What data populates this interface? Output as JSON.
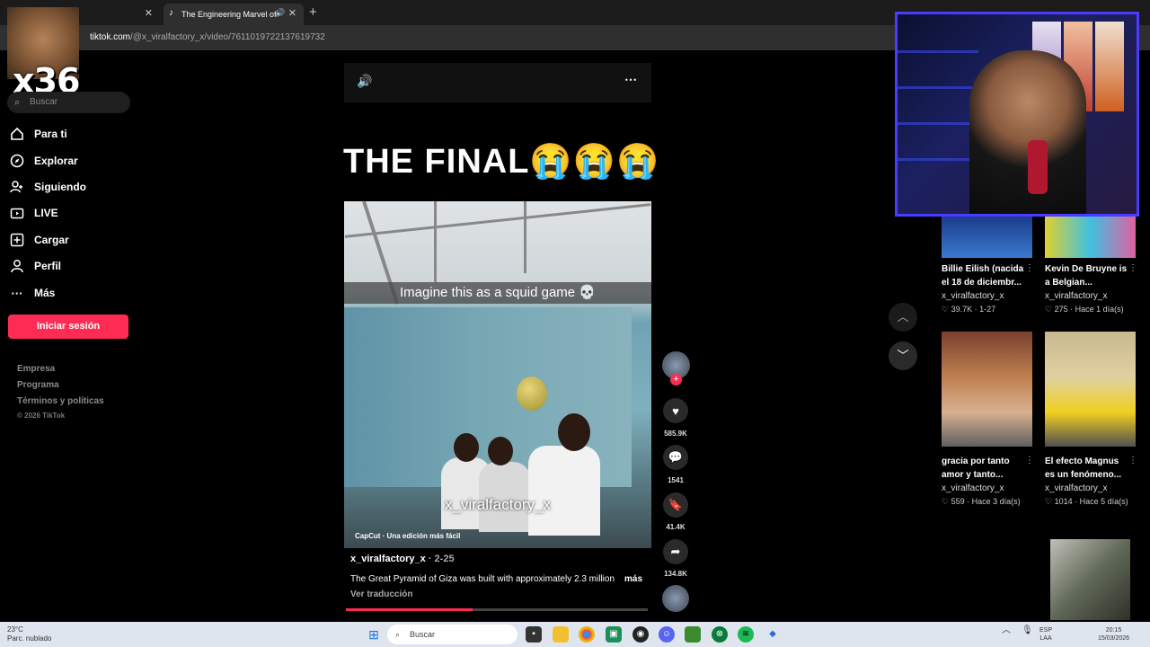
{
  "browser": {
    "tab1_title": "",
    "tab2_title": "The Engineering Marvel of",
    "url_domain": "tiktok.com",
    "url_path": "/@x_viralfactory_x/video/7611019722137619732"
  },
  "overlay": {
    "badge": "x36"
  },
  "sidebar": {
    "search_placeholder": "Buscar",
    "items": [
      {
        "label": "Para ti",
        "icon": "home-icon"
      },
      {
        "label": "Explorar",
        "icon": "compass-icon"
      },
      {
        "label": "Siguiendo",
        "icon": "following-icon"
      },
      {
        "label": "LIVE",
        "icon": "live-icon"
      },
      {
        "label": "Cargar",
        "icon": "upload-icon"
      },
      {
        "label": "Perfil",
        "icon": "profile-icon"
      },
      {
        "label": "Más",
        "icon": "more-icon"
      }
    ],
    "login_label": "Iniciar sesión",
    "footer": [
      "Empresa",
      "Programa",
      "Términos y políticas"
    ],
    "copyright": "© 2026 TikTok"
  },
  "video": {
    "headline": "THE FINAL😭😭😭",
    "caption_overlay": "Imagine this as a squid game 💀",
    "watermark": "x_viralfactory_x",
    "capcut": "CapCut · Una edición más fácil",
    "author": "x_viralfactory_x",
    "date": " · 2-25",
    "description": "The Great Pyramid of Giza was built with approximately 2.3 million",
    "more": "más",
    "translate": "Ver traducción",
    "progress": 0.42
  },
  "actions": {
    "likes": "585.9K",
    "comments": "1541",
    "saves": "41.4K",
    "shares": "134.8K"
  },
  "related": [
    {
      "title": "Billie Eilish (nacida el 18 de diciembr...",
      "author": "x_viralfactory_x",
      "likes": "39.7K",
      "date": "1-27"
    },
    {
      "title": "Kevin De Bruyne is a Belgian...",
      "author": "x_viralfactory_x",
      "likes": "275",
      "date": "Hace 1 día(s)"
    },
    {
      "title": "gracia por tanto amor y tanto...",
      "author": "x_viralfactory_x",
      "likes": "559",
      "date": "Hace 3 día(s)"
    },
    {
      "title": "El efecto Magnus es un fenómeno...",
      "author": "x_viralfactory_x",
      "likes": "1014",
      "date": "Hace 5 día(s)"
    }
  ],
  "taskbar": {
    "temp": "23°C",
    "weather": "Parc. nublado",
    "search": "Buscar",
    "lang1": "ESP",
    "lang2": "LAA",
    "time": "20:15",
    "date": "15/03/2026"
  }
}
